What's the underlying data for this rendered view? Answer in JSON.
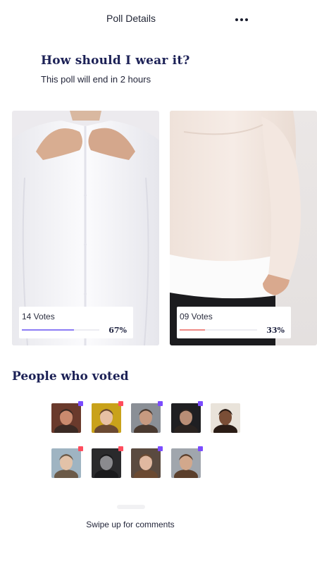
{
  "header": {
    "title": "Poll Details",
    "menu_icon": "more-horizontal-icon"
  },
  "poll": {
    "question": "How should I wear it?",
    "subtitle": "This poll will end in 2 hours",
    "options": [
      {
        "image": "white-shirt-photo",
        "votes_label": "14 Votes",
        "percent_label": "67%",
        "percent": 67,
        "bar_color": "#8c7cf5"
      },
      {
        "image": "sweatshirt-photo",
        "votes_label": "09 Votes",
        "percent_label": "33%",
        "percent": 33,
        "bar_color": "#ef8a86"
      }
    ]
  },
  "voters": {
    "title": "People who voted",
    "people": [
      {
        "name": "voter-1",
        "badge": "#7b4cff"
      },
      {
        "name": "voter-2",
        "badge": "#ff4d5e"
      },
      {
        "name": "voter-3",
        "badge": "#7b4cff"
      },
      {
        "name": "voter-4",
        "badge": "#7b4cff"
      },
      {
        "name": "voter-5",
        "badge": ""
      },
      {
        "name": "voter-6",
        "badge": "#ff4d5e"
      },
      {
        "name": "voter-7",
        "badge": "#ff4d5e"
      },
      {
        "name": "voter-8",
        "badge": "#7b4cff"
      },
      {
        "name": "voter-9",
        "badge": "#7b4cff"
      }
    ]
  },
  "footer": {
    "swipe_label": "Swipe up for comments"
  }
}
